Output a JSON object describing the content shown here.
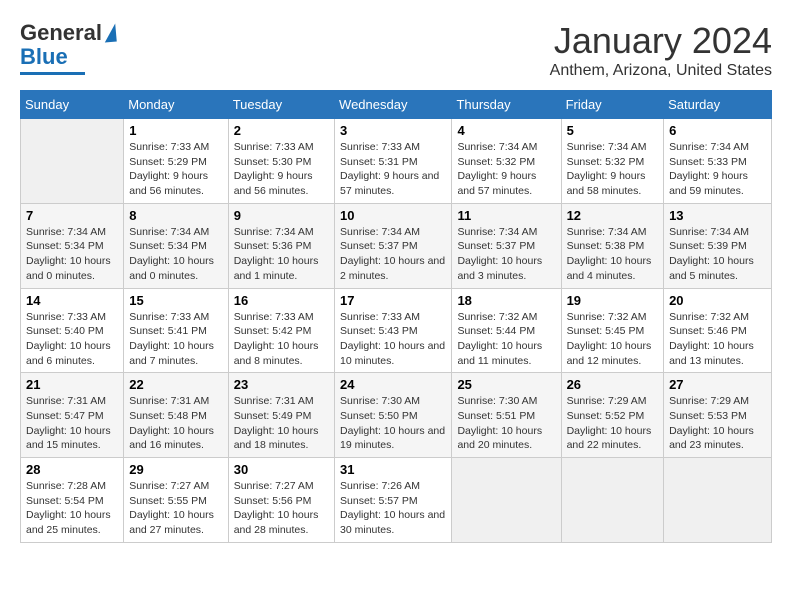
{
  "header": {
    "logo": {
      "general": "General",
      "blue": "Blue"
    },
    "title": "January 2024",
    "subtitle": "Anthem, Arizona, United States"
  },
  "calendar": {
    "days_of_week": [
      "Sunday",
      "Monday",
      "Tuesday",
      "Wednesday",
      "Thursday",
      "Friday",
      "Saturday"
    ],
    "weeks": [
      [
        {
          "day": "",
          "sunrise": "",
          "sunset": "",
          "daylight": "",
          "empty": true
        },
        {
          "day": "1",
          "sunrise": "Sunrise: 7:33 AM",
          "sunset": "Sunset: 5:29 PM",
          "daylight": "Daylight: 9 hours and 56 minutes.",
          "empty": false
        },
        {
          "day": "2",
          "sunrise": "Sunrise: 7:33 AM",
          "sunset": "Sunset: 5:30 PM",
          "daylight": "Daylight: 9 hours and 56 minutes.",
          "empty": false
        },
        {
          "day": "3",
          "sunrise": "Sunrise: 7:33 AM",
          "sunset": "Sunset: 5:31 PM",
          "daylight": "Daylight: 9 hours and 57 minutes.",
          "empty": false
        },
        {
          "day": "4",
          "sunrise": "Sunrise: 7:34 AM",
          "sunset": "Sunset: 5:32 PM",
          "daylight": "Daylight: 9 hours and 57 minutes.",
          "empty": false
        },
        {
          "day": "5",
          "sunrise": "Sunrise: 7:34 AM",
          "sunset": "Sunset: 5:32 PM",
          "daylight": "Daylight: 9 hours and 58 minutes.",
          "empty": false
        },
        {
          "day": "6",
          "sunrise": "Sunrise: 7:34 AM",
          "sunset": "Sunset: 5:33 PM",
          "daylight": "Daylight: 9 hours and 59 minutes.",
          "empty": false
        }
      ],
      [
        {
          "day": "7",
          "sunrise": "Sunrise: 7:34 AM",
          "sunset": "Sunset: 5:34 PM",
          "daylight": "Daylight: 10 hours and 0 minutes.",
          "empty": false
        },
        {
          "day": "8",
          "sunrise": "Sunrise: 7:34 AM",
          "sunset": "Sunset: 5:34 PM",
          "daylight": "Daylight: 10 hours and 0 minutes.",
          "empty": false
        },
        {
          "day": "9",
          "sunrise": "Sunrise: 7:34 AM",
          "sunset": "Sunset: 5:36 PM",
          "daylight": "Daylight: 10 hours and 1 minute.",
          "empty": false
        },
        {
          "day": "10",
          "sunrise": "Sunrise: 7:34 AM",
          "sunset": "Sunset: 5:37 PM",
          "daylight": "Daylight: 10 hours and 2 minutes.",
          "empty": false
        },
        {
          "day": "11",
          "sunrise": "Sunrise: 7:34 AM",
          "sunset": "Sunset: 5:37 PM",
          "daylight": "Daylight: 10 hours and 3 minutes.",
          "empty": false
        },
        {
          "day": "12",
          "sunrise": "Sunrise: 7:34 AM",
          "sunset": "Sunset: 5:38 PM",
          "daylight": "Daylight: 10 hours and 4 minutes.",
          "empty": false
        },
        {
          "day": "13",
          "sunrise": "Sunrise: 7:34 AM",
          "sunset": "Sunset: 5:39 PM",
          "daylight": "Daylight: 10 hours and 5 minutes.",
          "empty": false
        }
      ],
      [
        {
          "day": "14",
          "sunrise": "Sunrise: 7:33 AM",
          "sunset": "Sunset: 5:40 PM",
          "daylight": "Daylight: 10 hours and 6 minutes.",
          "empty": false
        },
        {
          "day": "15",
          "sunrise": "Sunrise: 7:33 AM",
          "sunset": "Sunset: 5:41 PM",
          "daylight": "Daylight: 10 hours and 7 minutes.",
          "empty": false
        },
        {
          "day": "16",
          "sunrise": "Sunrise: 7:33 AM",
          "sunset": "Sunset: 5:42 PM",
          "daylight": "Daylight: 10 hours and 8 minutes.",
          "empty": false
        },
        {
          "day": "17",
          "sunrise": "Sunrise: 7:33 AM",
          "sunset": "Sunset: 5:43 PM",
          "daylight": "Daylight: 10 hours and 10 minutes.",
          "empty": false
        },
        {
          "day": "18",
          "sunrise": "Sunrise: 7:32 AM",
          "sunset": "Sunset: 5:44 PM",
          "daylight": "Daylight: 10 hours and 11 minutes.",
          "empty": false
        },
        {
          "day": "19",
          "sunrise": "Sunrise: 7:32 AM",
          "sunset": "Sunset: 5:45 PM",
          "daylight": "Daylight: 10 hours and 12 minutes.",
          "empty": false
        },
        {
          "day": "20",
          "sunrise": "Sunrise: 7:32 AM",
          "sunset": "Sunset: 5:46 PM",
          "daylight": "Daylight: 10 hours and 13 minutes.",
          "empty": false
        }
      ],
      [
        {
          "day": "21",
          "sunrise": "Sunrise: 7:31 AM",
          "sunset": "Sunset: 5:47 PM",
          "daylight": "Daylight: 10 hours and 15 minutes.",
          "empty": false
        },
        {
          "day": "22",
          "sunrise": "Sunrise: 7:31 AM",
          "sunset": "Sunset: 5:48 PM",
          "daylight": "Daylight: 10 hours and 16 minutes.",
          "empty": false
        },
        {
          "day": "23",
          "sunrise": "Sunrise: 7:31 AM",
          "sunset": "Sunset: 5:49 PM",
          "daylight": "Daylight: 10 hours and 18 minutes.",
          "empty": false
        },
        {
          "day": "24",
          "sunrise": "Sunrise: 7:30 AM",
          "sunset": "Sunset: 5:50 PM",
          "daylight": "Daylight: 10 hours and 19 minutes.",
          "empty": false
        },
        {
          "day": "25",
          "sunrise": "Sunrise: 7:30 AM",
          "sunset": "Sunset: 5:51 PM",
          "daylight": "Daylight: 10 hours and 20 minutes.",
          "empty": false
        },
        {
          "day": "26",
          "sunrise": "Sunrise: 7:29 AM",
          "sunset": "Sunset: 5:52 PM",
          "daylight": "Daylight: 10 hours and 22 minutes.",
          "empty": false
        },
        {
          "day": "27",
          "sunrise": "Sunrise: 7:29 AM",
          "sunset": "Sunset: 5:53 PM",
          "daylight": "Daylight: 10 hours and 23 minutes.",
          "empty": false
        }
      ],
      [
        {
          "day": "28",
          "sunrise": "Sunrise: 7:28 AM",
          "sunset": "Sunset: 5:54 PM",
          "daylight": "Daylight: 10 hours and 25 minutes.",
          "empty": false
        },
        {
          "day": "29",
          "sunrise": "Sunrise: 7:27 AM",
          "sunset": "Sunset: 5:55 PM",
          "daylight": "Daylight: 10 hours and 27 minutes.",
          "empty": false
        },
        {
          "day": "30",
          "sunrise": "Sunrise: 7:27 AM",
          "sunset": "Sunset: 5:56 PM",
          "daylight": "Daylight: 10 hours and 28 minutes.",
          "empty": false
        },
        {
          "day": "31",
          "sunrise": "Sunrise: 7:26 AM",
          "sunset": "Sunset: 5:57 PM",
          "daylight": "Daylight: 10 hours and 30 minutes.",
          "empty": false
        },
        {
          "day": "",
          "sunrise": "",
          "sunset": "",
          "daylight": "",
          "empty": true
        },
        {
          "day": "",
          "sunrise": "",
          "sunset": "",
          "daylight": "",
          "empty": true
        },
        {
          "day": "",
          "sunrise": "",
          "sunset": "",
          "daylight": "",
          "empty": true
        }
      ]
    ]
  }
}
